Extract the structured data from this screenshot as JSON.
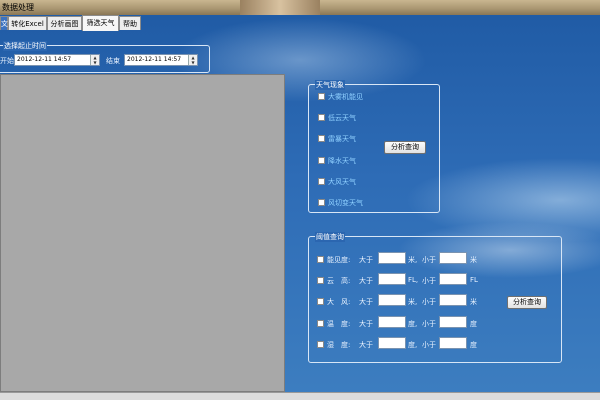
{
  "window": {
    "title": "数据处理"
  },
  "tabs": [
    {
      "label": "文"
    },
    {
      "label": "转化Excel"
    },
    {
      "label": "分析画图"
    },
    {
      "label": "筛选天气"
    },
    {
      "label": "帮助"
    }
  ],
  "time_group": {
    "legend": "选择起止时间",
    "start_label": "开始",
    "start_value": "2012-12-11 14:57",
    "end_label": "结束",
    "end_value": "2012-12-11 14:57"
  },
  "weather_group": {
    "legend": "天气现象",
    "items": [
      {
        "label": "大雾机能见"
      },
      {
        "label": "低云天气"
      },
      {
        "label": "雷暴天气"
      },
      {
        "label": "降水天气"
      },
      {
        "label": "大风天气"
      },
      {
        "label": "风切变天气"
      }
    ],
    "query_button": "分析查询"
  },
  "threshold_group": {
    "legend": "阈值查询",
    "rows": [
      {
        "name": "能见度:",
        "gt": "大于",
        "unit1": "米, ",
        "lt": "小于",
        "unit2": "米"
      },
      {
        "name": "云　高:",
        "gt": "大于",
        "unit1": "FL, ",
        "lt": "小于",
        "unit2": "FL"
      },
      {
        "name": "大　风:",
        "gt": "大于",
        "unit1": "米, ",
        "lt": "小于",
        "unit2": "米"
      },
      {
        "name": "温　度:",
        "gt": "大于",
        "unit1": "度, ",
        "lt": "小于",
        "unit2": "度"
      },
      {
        "name": "湿　度:",
        "gt": "大于",
        "unit1": "度, ",
        "lt": "小于",
        "unit2": "度"
      }
    ],
    "query_button": "分析查询"
  },
  "colors": {
    "background": "#2e6cb6",
    "weather_text": "#8fd0ff"
  }
}
